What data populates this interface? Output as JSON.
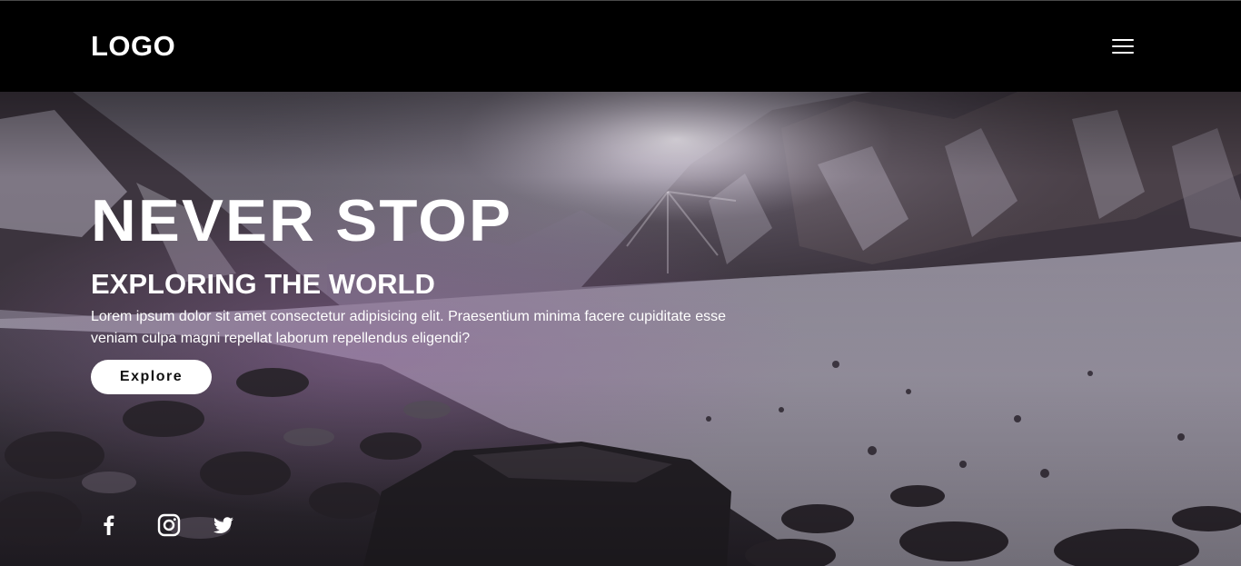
{
  "header": {
    "logo": "LOGO",
    "menu_icon": "hamburger-menu-icon"
  },
  "hero": {
    "title": "NEVER STOP",
    "subtitle": "EXPLORING THE WORLD",
    "text": "Lorem ipsum dolor sit amet consectetur adipisicing elit. Praesentium minima facere cupiditate esse veniam culpa magni repellat laborum repellendus eligendi?",
    "button_label": "Explore",
    "background_image": "snowy-mountain-valley-image"
  },
  "social": {
    "icons": [
      "facebook-icon",
      "instagram-icon",
      "twitter-icon"
    ]
  },
  "colors": {
    "header_bg": "#000000",
    "text": "#ffffff",
    "button_bg": "#ffffff",
    "button_text": "#111111"
  }
}
